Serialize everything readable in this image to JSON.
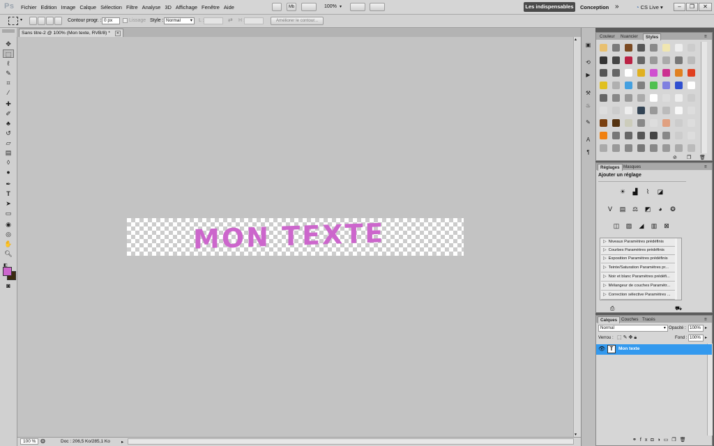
{
  "app": {
    "logo": "Ps"
  },
  "menu": [
    "Fichier",
    "Edition",
    "Image",
    "Calque",
    "Sélection",
    "Filtre",
    "Analyse",
    "3D",
    "Affichage",
    "Fenêtre",
    "Aide"
  ],
  "appbar": {
    "zoom": "100%",
    "workspace_active": "Les indispensables",
    "workspace_other": "Conception",
    "more": "»",
    "cs_live": "CS Live"
  },
  "options": {
    "feather_label": "Contour progr. :",
    "feather_value": "0 px",
    "antialias_label": "Lissage",
    "style_label": "Style :",
    "style_value": "Normal",
    "width_label": "L :",
    "height_label": "H :",
    "refine_button": "Améliorer le contour..."
  },
  "document": {
    "tab_title": "Sans titre-2 @ 100% (Mon texte, RVB/8) *",
    "text": "MON TEXTE",
    "text_color": "#cc66cc"
  },
  "status": {
    "zoom": "100 %",
    "doc_info": "Doc : 206,5 Ko/285,1 Ko"
  },
  "panels": {
    "styles_tabs": [
      "Couleur",
      "Nuancier",
      "Styles"
    ],
    "adjust_tabs": [
      "Réglages",
      "Masques"
    ],
    "adjust_title": "Ajouter un réglage",
    "presets": [
      "Niveaux Paramètres prédéfinis",
      "Courbes Paramètres prédéfinis",
      "Exposition Paramètres prédéfinis",
      "Teinte/Saturation Paramètres pr...",
      "Noir et blanc Paramètres prédéfi...",
      "Mélangeur de couches Paramètr...",
      "Correction sélective Paramètres ..."
    ],
    "layers_tabs": [
      "Calques",
      "Couches",
      "Tracés"
    ],
    "blend_mode": "Normal",
    "opacity_label": "Opacité :",
    "opacity_value": "100%",
    "lock_label": "Verrou :",
    "fill_label": "Fond :",
    "fill_value": "100%",
    "layer_name": "Mon texte",
    "layer_type": "T"
  },
  "colors": {
    "foreground": "#cc66cc",
    "background": "#3a2a10",
    "selected_layer": "#3399ee"
  }
}
